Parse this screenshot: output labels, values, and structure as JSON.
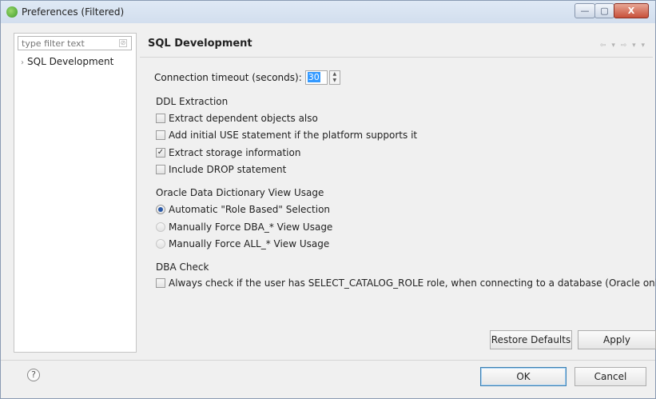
{
  "window": {
    "title": "Preferences (Filtered)",
    "min_label": "—",
    "max_label": "▢",
    "close_label": "X"
  },
  "sidebar": {
    "filter_placeholder": "type filter text",
    "items": [
      {
        "label": "SQL Development"
      }
    ]
  },
  "page": {
    "title": "SQL Development",
    "nav_glyphs": "⇦ ▾ ⇨ ▾ ▾",
    "timeout_label": "Connection timeout (seconds):",
    "timeout_value": "30",
    "ddl": {
      "label": "DDL Extraction",
      "options": [
        {
          "label": "Extract dependent objects also",
          "checked": false
        },
        {
          "label": "Add initial USE statement if the platform supports it",
          "checked": false
        },
        {
          "label": "Extract storage information",
          "checked": true
        },
        {
          "label": "Include DROP statement",
          "checked": false
        }
      ]
    },
    "dictionary": {
      "label": "Oracle Data Dictionary View Usage",
      "options": [
        {
          "label": "Automatic \"Role Based\" Selection",
          "selected": true
        },
        {
          "label": "Manually Force DBA_* View Usage",
          "selected": false
        },
        {
          "label": "Manually Force ALL_* View Usage",
          "selected": false
        }
      ]
    },
    "dba_check": {
      "label": "DBA Check",
      "option": "Always check if the user has SELECT_CATALOG_ROLE role, when connecting to a database (Oracle only)",
      "checked": false
    },
    "restore_defaults_label": "Restore Defaults",
    "apply_label": "Apply"
  },
  "footer": {
    "help_glyph": "?",
    "ok_label": "OK",
    "cancel_label": "Cancel"
  },
  "colors": {
    "selection": "#3399ff",
    "primary_border": "#3c7fb1"
  }
}
